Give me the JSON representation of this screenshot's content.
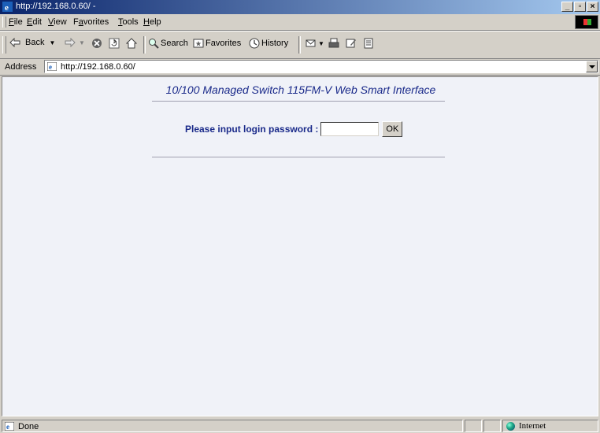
{
  "window": {
    "title": "http://192.168.0.60/ -",
    "controls": {
      "minimize": "_",
      "maximize": "▫",
      "close": "×"
    }
  },
  "menubar": {
    "items": [
      {
        "label": "File",
        "key": "F",
        "rest": "ile"
      },
      {
        "label": "Edit",
        "key": "E",
        "rest": "dit"
      },
      {
        "label": "View",
        "key": "V",
        "rest": "iew"
      },
      {
        "label": "Favorites",
        "key": "a",
        "pre": "F",
        "rest": "vorites"
      },
      {
        "label": "Tools",
        "key": "T",
        "rest": "ools"
      },
      {
        "label": "Help",
        "key": "H",
        "rest": "elp"
      }
    ]
  },
  "toolbar": {
    "back_label": "Back",
    "search_label": "Search",
    "favorites_label": "Favorites",
    "history_label": "History"
  },
  "address": {
    "label": "Address",
    "url": "http://192.168.0.60/"
  },
  "page": {
    "heading": "10/100 Managed Switch 115FM-V Web Smart Interface",
    "password_label": "Please input login password :",
    "password_value": "",
    "ok_label": "OK"
  },
  "status": {
    "text": "Done",
    "zone": "Internet"
  },
  "colors": {
    "heading": "#1a2a8a",
    "content_bg": "#f0f2f8",
    "chrome": "#d4d0c8",
    "titlebar_start": "#0a246a"
  }
}
